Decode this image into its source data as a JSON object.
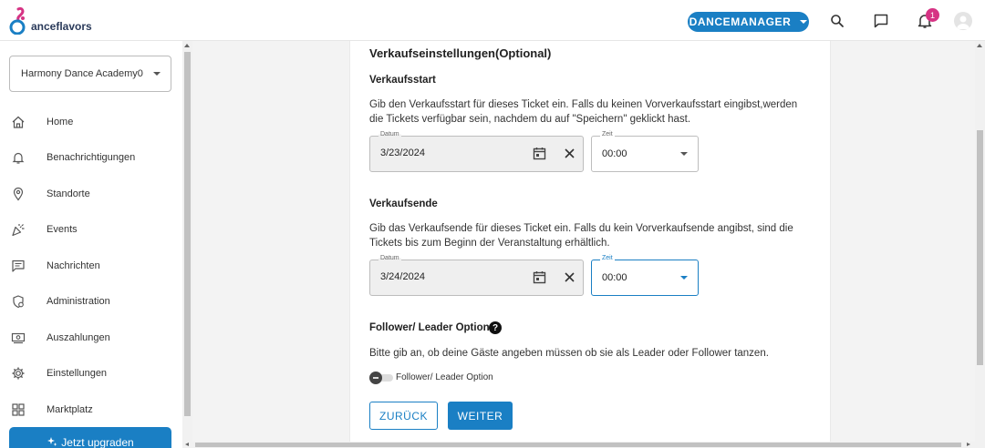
{
  "header": {
    "logo_text": "anceflavors",
    "role_button": "DANCEMANAGER",
    "notification_count": "1",
    "icons": [
      "search-icon",
      "chat-icon",
      "bell-icon",
      "user-avatar-icon"
    ],
    "accent_color": "#1a7fc4",
    "badge_color": "#d63384"
  },
  "sidebar": {
    "academy_select": "Harmony Dance Academy0",
    "items": [
      {
        "label": "Home",
        "icon": "home-icon"
      },
      {
        "label": "Benachrichtigungen",
        "icon": "bell-icon"
      },
      {
        "label": "Standorte",
        "icon": "location-pin-icon"
      },
      {
        "label": "Events",
        "icon": "party-popper-icon"
      },
      {
        "label": "Nachrichten",
        "icon": "message-icon"
      },
      {
        "label": "Administration",
        "icon": "admin-icon"
      },
      {
        "label": "Auszahlungen",
        "icon": "payout-icon"
      },
      {
        "label": "Einstellungen",
        "icon": "gear-icon"
      },
      {
        "label": "Marktplatz",
        "icon": "grid-icon"
      }
    ],
    "upgrade_button": "Jetzt upgraden"
  },
  "main": {
    "section_title": "Verkaufseinstellungen(Optional)",
    "sale_start": {
      "title": "Verkaufsstart",
      "description": "Gib den Verkaufsstart für dieses Ticket ein. Falls du keinen Vorverkaufsstart eingibst,werden die Tickets verfügbar sein, nachdem du auf \"Speichern\" geklickt hast.",
      "date_label": "Datum",
      "date_value": "3/23/2024",
      "time_label": "Zeit",
      "time_value": "00:00"
    },
    "sale_end": {
      "title": "Verkaufsende",
      "description": "Gib das Verkaufsende für dieses Ticket ein. Falls du kein Vorverkaufsende angibst, sind die Tickets bis zum Beginn der Veranstaltung erhältlich.",
      "date_label": "Datum",
      "date_value": "3/24/2024",
      "time_label": "Zeit",
      "time_value": "00:00"
    },
    "follower_leader": {
      "title": "Follower/ Leader Option",
      "help": "?",
      "description": "Bitte gib an, ob deine Gäste angeben müssen ob sie als Leader oder Follower tanzen.",
      "toggle_label": "Follower/ Leader Option",
      "toggle_on": false
    },
    "back_button": "ZURÜCK",
    "next_button": "WEITER"
  }
}
